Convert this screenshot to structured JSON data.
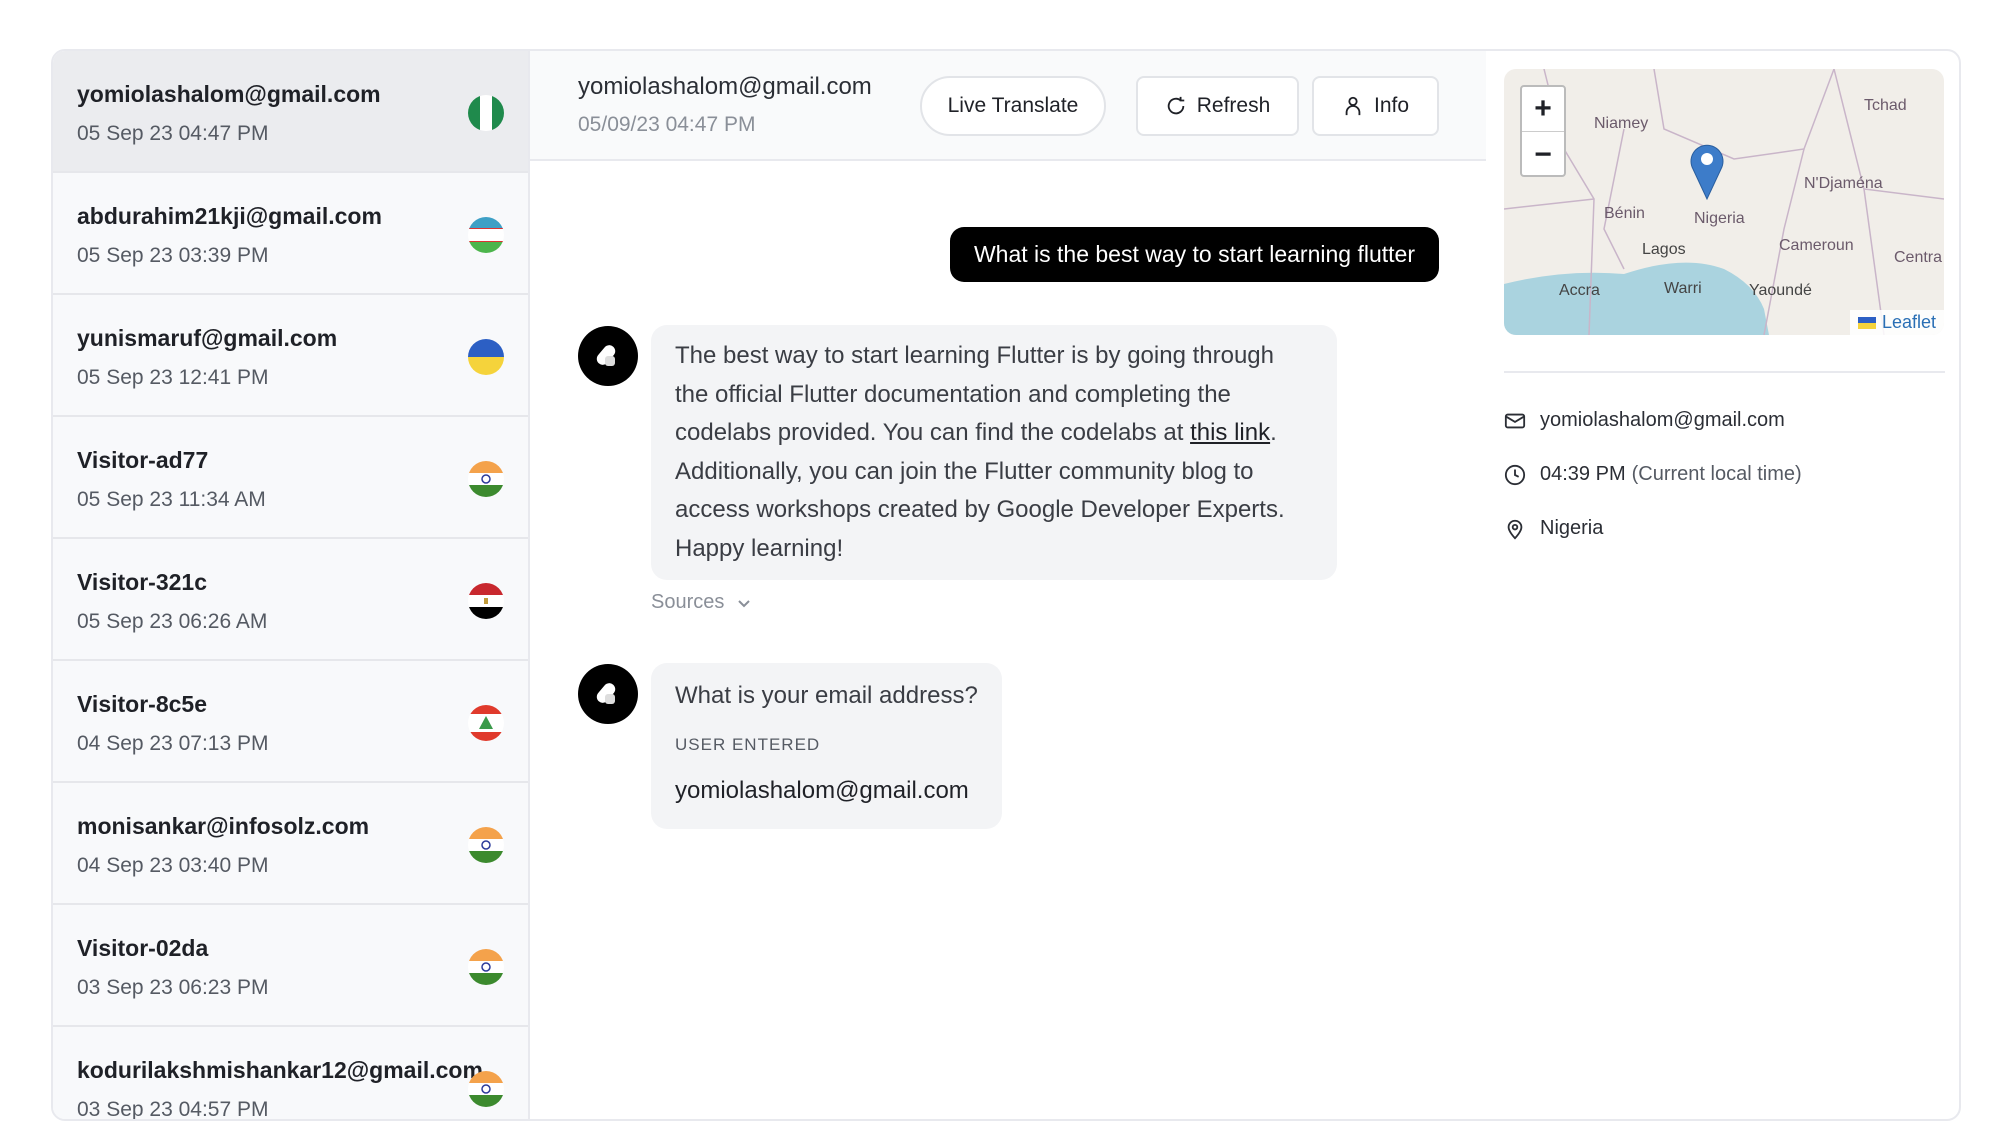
{
  "conversations": [
    {
      "name": "yomiolashalom@gmail.com",
      "date": "05 Sep 23 04:47 PM",
      "flag": "nigeria"
    },
    {
      "name": "abdurahim21kji@gmail.com",
      "date": "05 Sep 23 03:39 PM",
      "flag": "uzbekistan"
    },
    {
      "name": "yunismaruf@gmail.com",
      "date": "05 Sep 23 12:41 PM",
      "flag": "ukraine"
    },
    {
      "name": "Visitor-ad77",
      "date": "05 Sep 23 11:34 AM",
      "flag": "india"
    },
    {
      "name": "Visitor-321c",
      "date": "05 Sep 23 06:26 AM",
      "flag": "egypt"
    },
    {
      "name": "Visitor-8c5e",
      "date": "04 Sep 23 07:13 PM",
      "flag": "lebanon"
    },
    {
      "name": "monisankar@infosolz.com",
      "date": "04 Sep 23 03:40 PM",
      "flag": "india"
    },
    {
      "name": "Visitor-02da",
      "date": "03 Sep 23 06:23 PM",
      "flag": "india"
    },
    {
      "name": "kodurilakshmishankar12@gmail.com",
      "date": "03 Sep 23 04:57 PM",
      "flag": "india"
    }
  ],
  "chat": {
    "header": {
      "name": "yomiolashalom@gmail.com",
      "date": "05/09/23 04:47 PM",
      "live_translate": "Live Translate",
      "refresh": "Refresh",
      "info": "Info"
    },
    "user_message": "What is the best way to start learning flutter",
    "bot_message_1": {
      "before": "The best way to start learning Flutter is by going through the official Flutter documentation and completing the codelabs provided. You can find the codelabs at ",
      "link": "this link",
      "after": ". Additionally, you can join the Flutter community blog to access workshops created by Google Developer Experts. Happy learning!"
    },
    "sources": "Sources",
    "bot_message_2": {
      "question": "What is your email address?",
      "label": "USER ENTERED",
      "value": "yomiolashalom@gmail.com"
    }
  },
  "details": {
    "map": {
      "zoom_in": "+",
      "zoom_out": "−",
      "attribution": "Leaflet",
      "labels": [
        "Niamey",
        "Tchad",
        "N'Djaména",
        "Bénin",
        "Nigeria",
        "Cameroun",
        "Lagos",
        "Accra",
        "Warri",
        "Yaoundé",
        "Centra"
      ]
    },
    "email": "yomiolashalom@gmail.com",
    "time": "04:39 PM",
    "time_note": "(Current local time)",
    "location": "Nigeria"
  },
  "colors": {
    "accent": "#000000",
    "bubble": "#f3f4f6",
    "active_row": "#ebecef"
  }
}
